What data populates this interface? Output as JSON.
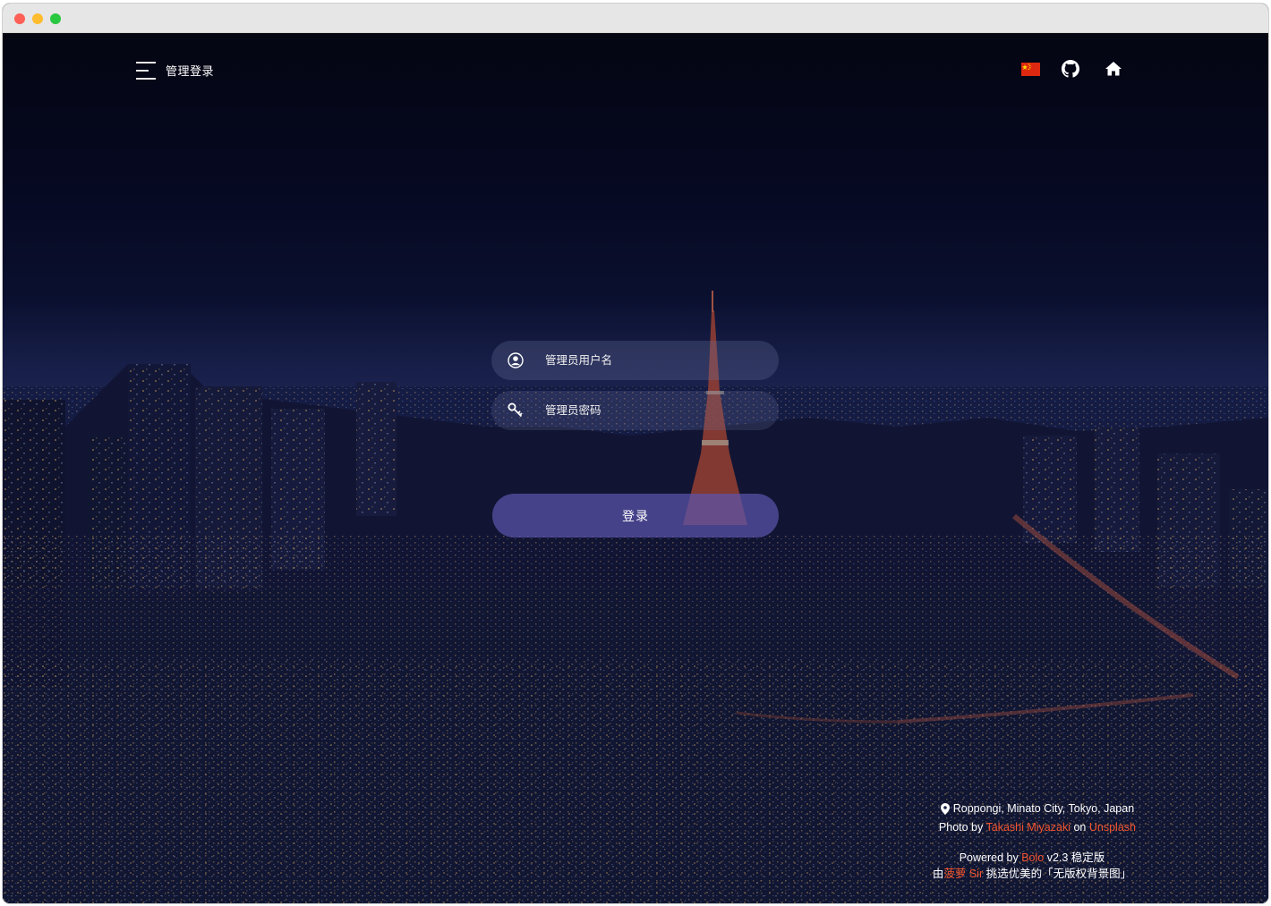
{
  "header": {
    "title": "管理登录",
    "menu_icon": "hamburger-menu-icon",
    "language_icon": "china-flag-icon",
    "github_icon": "github-icon",
    "home_icon": "home-icon"
  },
  "form": {
    "username_placeholder": "管理员用户名",
    "password_placeholder": "管理员密码",
    "username_icon": "user-circle-icon",
    "password_icon": "key-icon",
    "submit_label": "登录"
  },
  "photo_credit": {
    "location": "Roppongi, Minato City, Tokyo, Japan",
    "photo_by_prefix": "Photo by",
    "photographer": "Takashi Miyazaki",
    "on_text": "on",
    "source": "Unsplash"
  },
  "footer": {
    "powered_by_prefix": "Powered by",
    "product": "Bolo",
    "version": "v2.3 稳定版",
    "by_prefix": "由",
    "curator": "菠萝 Sir",
    "curator_suffix": "挑选优美的「无版权背景图」"
  },
  "colors": {
    "accent_link": "#f2542d",
    "button_bg": "#5c54aa",
    "sky_top": "#02030b",
    "horizon": "#1c2452"
  }
}
